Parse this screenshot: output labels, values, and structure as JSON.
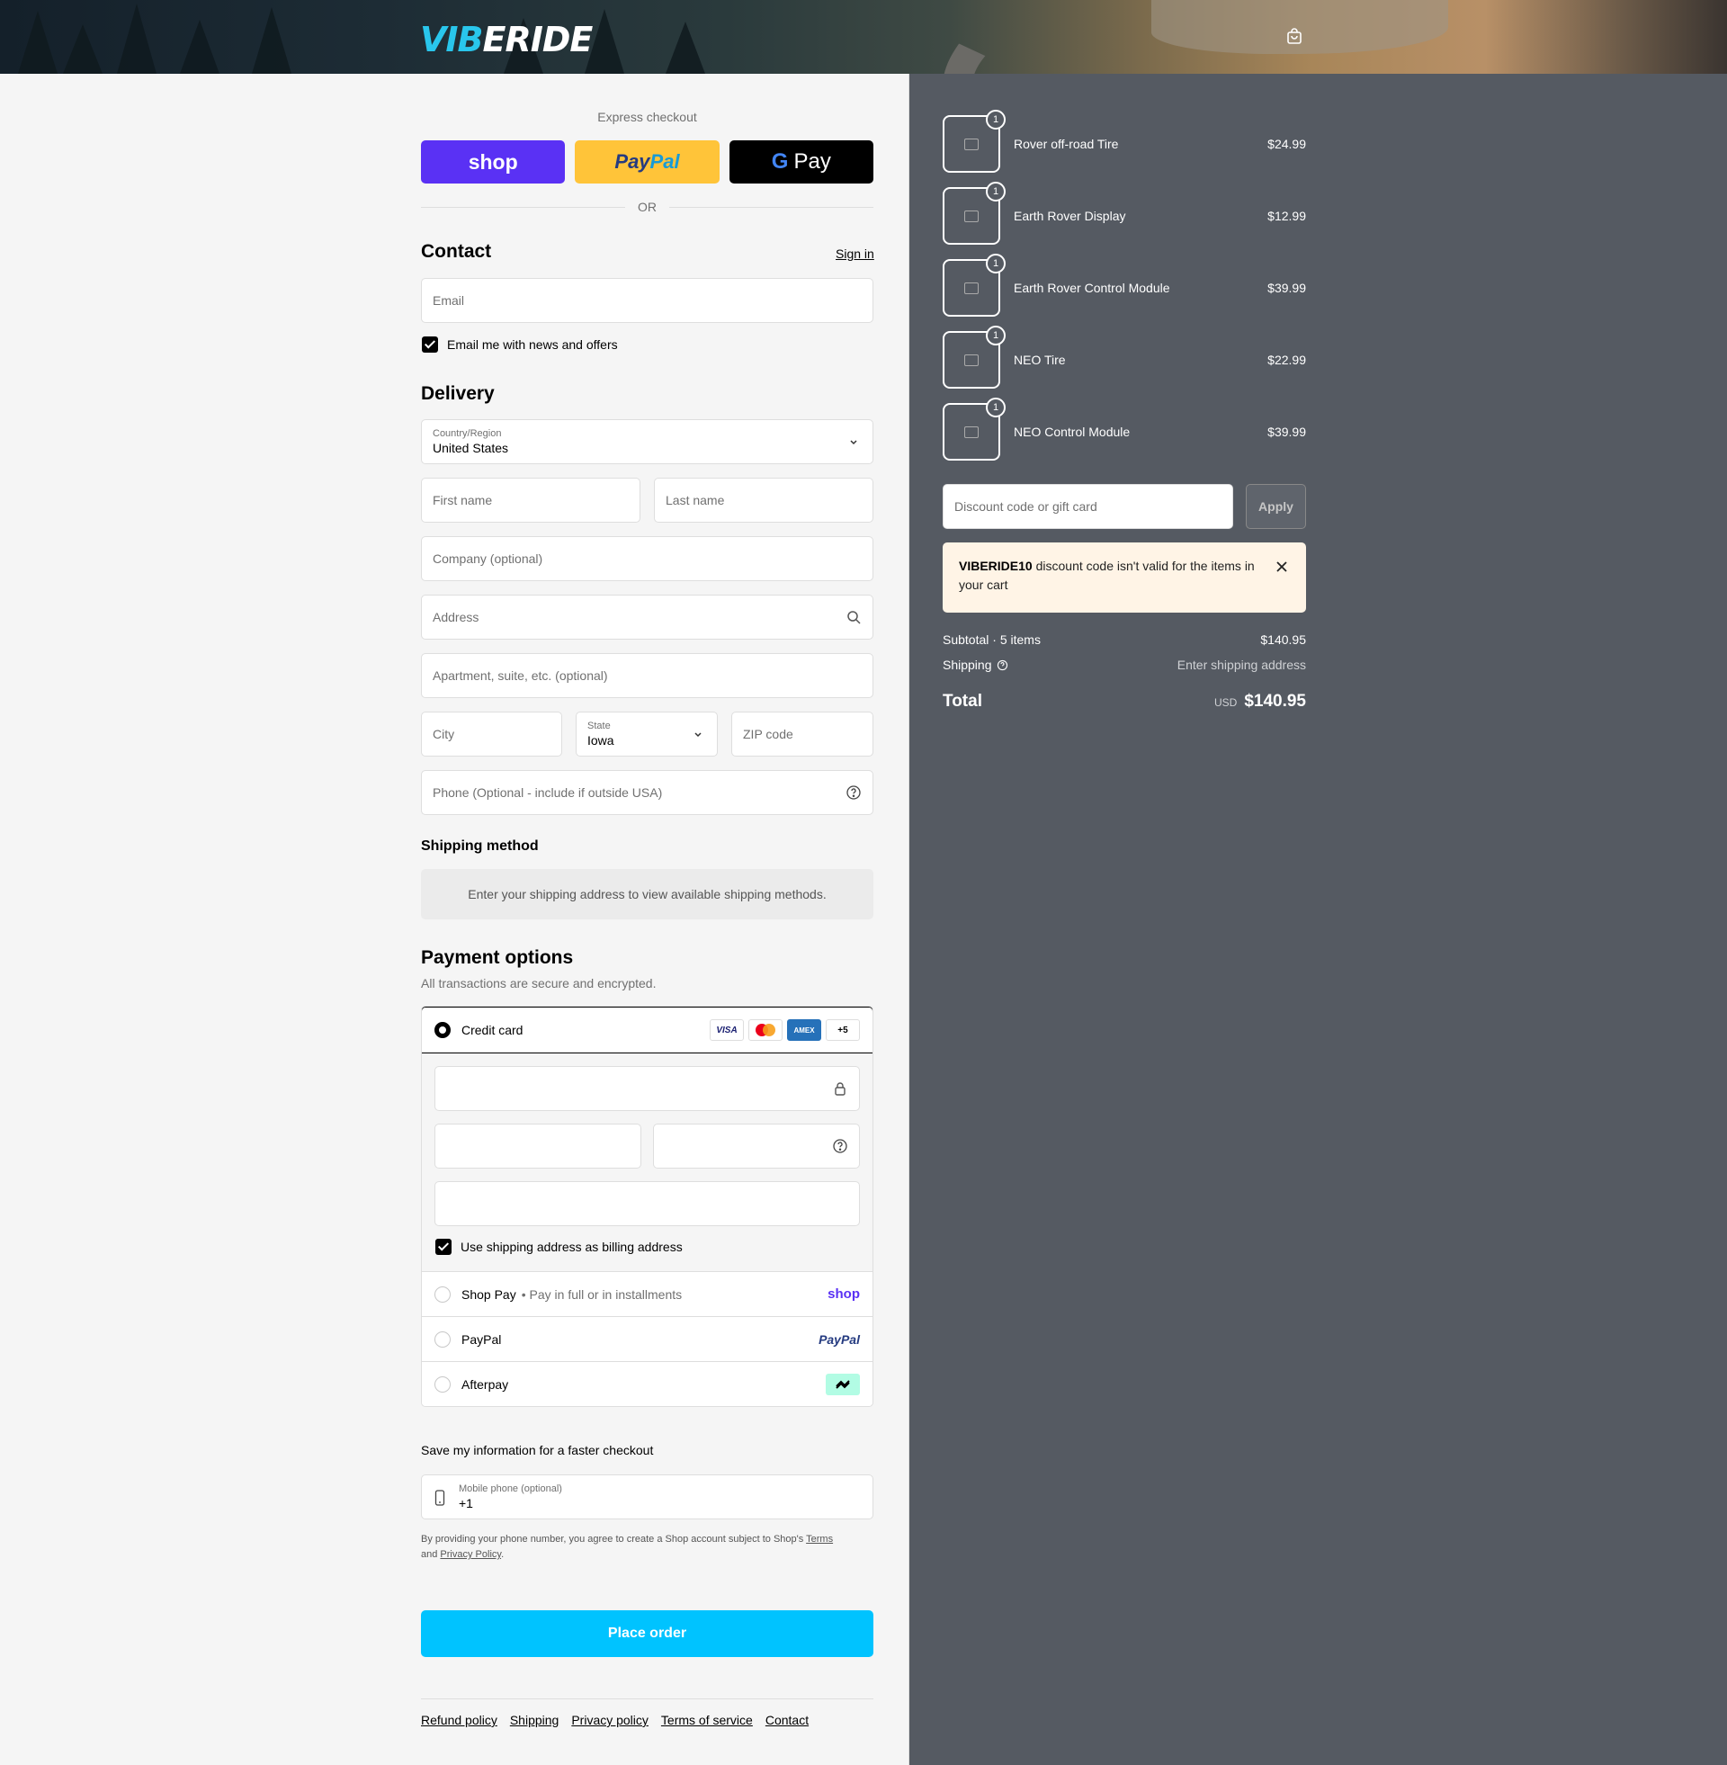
{
  "header": {
    "logo_part1": "VIB",
    "logo_part2": "ERIDE",
    "cart_icon": "shopping-bag-icon"
  },
  "express": {
    "label": "Express checkout",
    "shop": "shop",
    "paypal_a": "Pay",
    "paypal_b": "Pal",
    "gpay": "Pay",
    "or": "OR"
  },
  "contact": {
    "title": "Contact",
    "sign_in": "Sign in",
    "email_placeholder": "Email",
    "news_label": "Email me with news and offers"
  },
  "delivery": {
    "title": "Delivery",
    "country_label": "Country/Region",
    "country_value": "United States",
    "first_name": "First name",
    "last_name": "Last name",
    "company": "Company (optional)",
    "address": "Address",
    "apartment": "Apartment, suite, etc. (optional)",
    "city": "City",
    "state_label": "State",
    "state_value": "Iowa",
    "zip": "ZIP code",
    "phone": "Phone (Optional - include if outside USA)"
  },
  "shipping_method": {
    "title": "Shipping method",
    "note": "Enter your shipping address to view available shipping methods."
  },
  "payment": {
    "title": "Payment options",
    "subtitle": "All transactions are secure and encrypted.",
    "credit_card": "Credit card",
    "card_visa": "VISA",
    "card_amex": "AMEX",
    "card_more": "+5",
    "billing_label": "Use shipping address as billing address",
    "shop_pay": "Shop Pay",
    "shop_pay_sub": "Pay in full or in installments",
    "shop_brand": "shop",
    "paypal": "PayPal",
    "paypal_brand": "PayPal",
    "afterpay": "Afterpay"
  },
  "save_info": {
    "title": "Save my information for a faster checkout",
    "mobile_label": "Mobile phone (optional)",
    "mobile_value": "+1",
    "legal_text": "By providing your phone number, you agree to create a Shop account subject to Shop's",
    "terms": "Terms",
    "and": "and",
    "privacy": "Privacy Policy"
  },
  "place_order": "Place order",
  "footer": [
    "Refund policy",
    "Shipping",
    "Privacy policy",
    "Terms of service",
    "Contact"
  ],
  "cart": {
    "items": [
      {
        "qty": "1",
        "name": "Rover off-road Tire",
        "price": "$24.99"
      },
      {
        "qty": "1",
        "name": "Earth Rover Display",
        "price": "$12.99"
      },
      {
        "qty": "1",
        "name": "Earth Rover Control Module",
        "price": "$39.99"
      },
      {
        "qty": "1",
        "name": "NEO Tire",
        "price": "$22.99"
      },
      {
        "qty": "1",
        "name": "NEO Control Module",
        "price": "$39.99"
      }
    ],
    "discount_placeholder": "Discount code or gift card",
    "apply": "Apply",
    "alert_code": "VIBERIDE10",
    "alert_text": "discount code isn't valid for the items in your cart",
    "subtotal_label": "Subtotal · 5 items",
    "subtotal_value": "$140.95",
    "shipping_label": "Shipping",
    "shipping_value": "Enter shipping address",
    "total_label": "Total",
    "currency": "USD",
    "total_value": "$140.95"
  },
  "colors": {
    "accent": "#00c3ff",
    "shop_purple": "#5a31f4",
    "paypal_yellow": "#ffc439",
    "sidebar_bg": "#555a62",
    "alert_bg": "#fff4e6"
  }
}
